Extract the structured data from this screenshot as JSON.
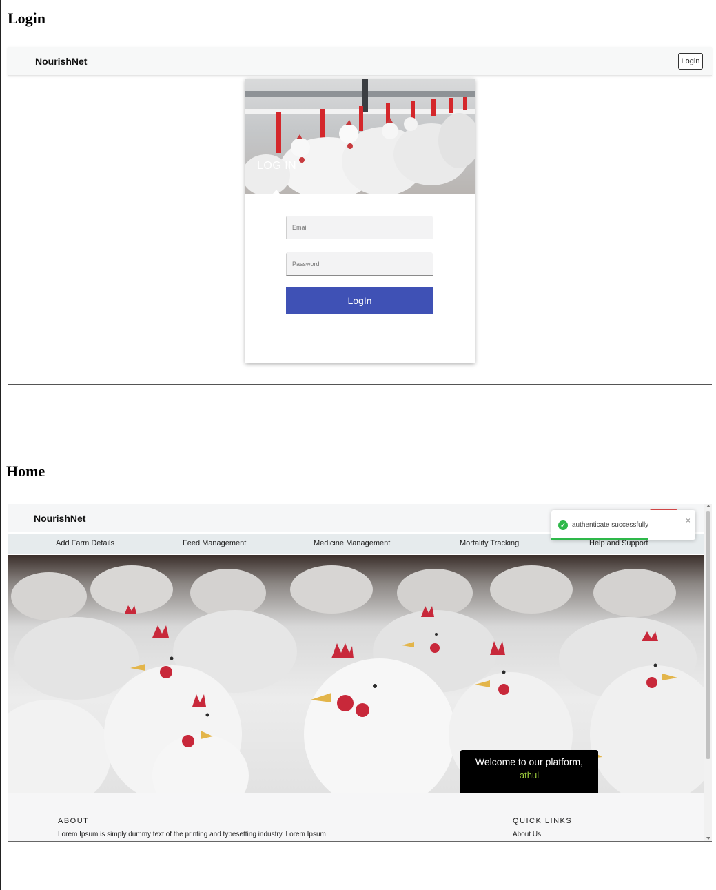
{
  "sections": {
    "login_heading": "Login",
    "home_heading": "Home"
  },
  "login_page": {
    "brand": "NourishNet",
    "nav_login_button": "Login",
    "card": {
      "hero_title": "LOG IN",
      "email_placeholder": "Email",
      "password_placeholder": "Password",
      "submit_label": "LogIn"
    }
  },
  "home_page": {
    "brand": "NourishNet",
    "menu": [
      {
        "label": "Add Farm Details"
      },
      {
        "label": "Feed Management"
      },
      {
        "label": "Medicine Management"
      },
      {
        "label": "Mortality Tracking"
      },
      {
        "label": "Help and Support"
      }
    ],
    "toast": {
      "message": "authenticate successfully",
      "close_glyph": "×",
      "status_color": "#2eb84a"
    },
    "welcome": {
      "line": "Welcome to our platform,",
      "username": "athul"
    },
    "footer": {
      "about_heading": "ABOUT",
      "about_text": "Lorem Ipsum is simply dummy text of the printing and typesetting industry. Lorem Ipsum",
      "links_heading": "QUICK LINKS",
      "links": [
        {
          "label": "About Us"
        }
      ]
    }
  },
  "colors": {
    "primary_button": "#3f51b5",
    "welcome_username": "#9ccc3c"
  },
  "icons": {
    "toast_status": "check-circle-icon",
    "toast_close": "close-icon"
  }
}
